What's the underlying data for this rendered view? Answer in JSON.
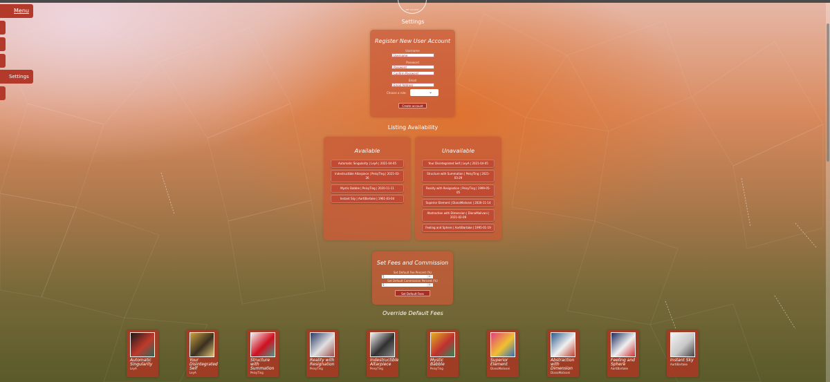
{
  "nav": {
    "menu_label": "Menu",
    "settings_label": "Settings"
  },
  "logo": {
    "text": "ART GALLERY"
  },
  "page_title": "Settings",
  "register": {
    "title": "Register New User Account",
    "username_label": "Username",
    "username_placeholder": "Username",
    "password_label": "Password",
    "password_placeholder": "Password",
    "confirm_placeholder": "Confirm Password",
    "email_label": "Email",
    "email_placeholder": "Email Address",
    "role_label": "Choose a role:",
    "role_value": "",
    "submit_label": "Create account"
  },
  "availability": {
    "title": "Listing Availability",
    "available_title": "Available",
    "available_items": [
      "Automatic Singularity | LeyA | 2021-04-05",
      "Indestructible Altarpiece | PeisyTing | 2021-03-26",
      "Mystic Babble | PeisyTing | 2020-11-11",
      "Instant Sky | AartiBartake | 1961-03-04"
    ],
    "unavailable_title": "Unavailable",
    "unavailable_items": [
      "Your Disintegrated Self | LeyA | 2021-04-05",
      "Structure with Summation | PeisyTing | 2021-03-29",
      "Reality with Resignation | PeisyTing | 1999-05-05",
      "Superior Element | DianaMalivani | 2020-11-14",
      "Abstraction with Dimension | DianaMalivani | 2021-02-09",
      "Feeling and Sphere | AartiBartake | 1995-01-19"
    ]
  },
  "fees": {
    "title": "Set Fees and Commission",
    "fee_label": "Set Default Fee Percent (%)",
    "fee_value": "5",
    "commission_label": "Set Default Commission Percent (%)",
    "commission_value": "5",
    "button_label": "Set Default Fees"
  },
  "override_title": "Override Default Fees",
  "artworks": [
    {
      "title": "Automatic Singularity",
      "artist": "LeyA",
      "colors": [
        "#1a1a1a",
        "#c0392b",
        "#2a6a5a"
      ]
    },
    {
      "title": "Your Disintegrated Self",
      "artist": "LeyA",
      "colors": [
        "#c8a040",
        "#3a3020",
        "#e0c070"
      ]
    },
    {
      "title": "Structure with Summation",
      "artist": "PeisyTing",
      "colors": [
        "#f0f0f0",
        "#d01020",
        "#4a9a8a"
      ]
    },
    {
      "title": "Reality with Resignation",
      "artist": "PeisyTing",
      "colors": [
        "#2a3a6a",
        "#e0e0e0",
        "#a05050"
      ]
    },
    {
      "title": "Indestructible Altarpiece",
      "artist": "PeisyTing",
      "colors": [
        "#f4f4f4",
        "#303030",
        "#888888"
      ]
    },
    {
      "title": "Mystic Babble",
      "artist": "PeisyTing",
      "colors": [
        "#e0b020",
        "#c03030",
        "#2a8a5a"
      ]
    },
    {
      "title": "Superior Element",
      "artist": "DianaMalivani",
      "colors": [
        "#e04080",
        "#f0c030",
        "#3070c0"
      ]
    },
    {
      "title": "Abstraction with Dimension",
      "artist": "DianaMalivani",
      "colors": [
        "#2a5a8a",
        "#f0f0f0",
        "#c04030"
      ]
    },
    {
      "title": "Feeling and Sphere",
      "artist": "AartiBartake",
      "colors": [
        "#1a2a5a",
        "#f0f0f0",
        "#d03030"
      ]
    },
    {
      "title": "Instant Sky",
      "artist": "AartiBartake",
      "colors": [
        "#f4f4f4",
        "#c8c8c8",
        "#444444"
      ]
    }
  ]
}
